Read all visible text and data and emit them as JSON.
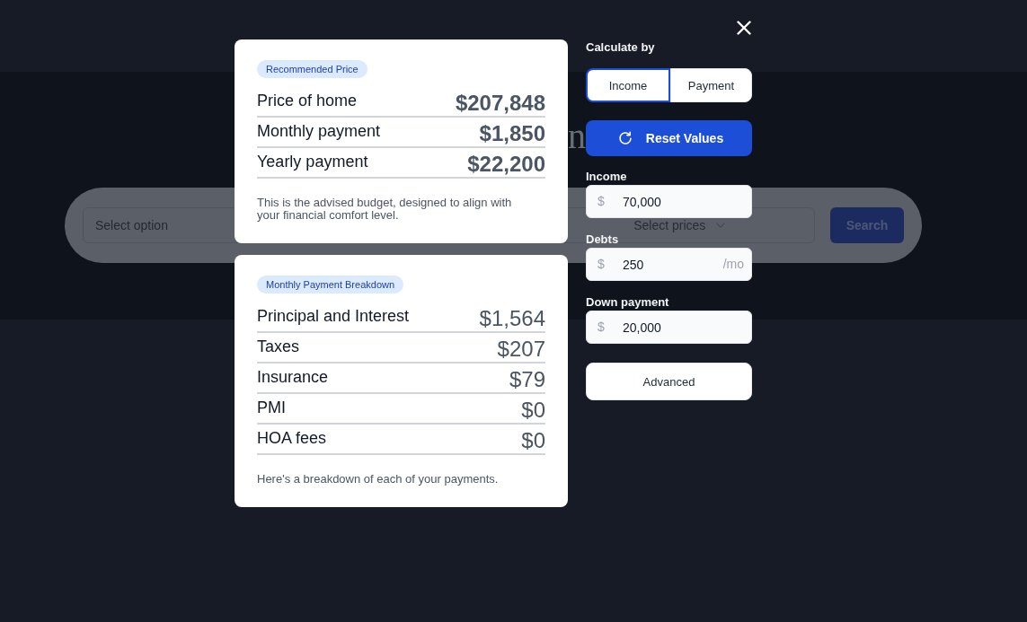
{
  "page": {
    "heading": "n",
    "search": {
      "option_select": {
        "placeholder": "Select option"
      },
      "price_select": {
        "label": "Select prices"
      },
      "search_button": "Search"
    }
  },
  "modal": {
    "cards": [
      {
        "kind": "summary",
        "badge": "Recommended Price",
        "rows": [
          {
            "label": "Price of home",
            "value": "$207,848"
          },
          {
            "label": "Monthly payment",
            "value": "$1,850"
          },
          {
            "label": "Yearly payment",
            "value": "$22,200"
          }
        ],
        "note": "This is the advised budget, designed to align with your financial comfort level."
      },
      {
        "kind": "breakdown",
        "badge": "Monthly Payment Breakdown",
        "rows": [
          {
            "label": "Principal and Interest",
            "value": "$1,564"
          },
          {
            "label": "Taxes",
            "value": "$207"
          },
          {
            "label": "Insurance",
            "value": "$79"
          },
          {
            "label": "PMI",
            "value": "$0"
          },
          {
            "label": "HOA fees",
            "value": "$0"
          }
        ],
        "note": "Here's a breakdown of each of your payments."
      }
    ],
    "calculate_by": {
      "label": "Calculate by",
      "options": [
        {
          "label": "Income",
          "selected": true
        },
        {
          "label": "Payment",
          "selected": false
        }
      ]
    },
    "reset_button": "Reset Values",
    "fields": [
      {
        "label": "Income",
        "prefix": "$",
        "value": "70,000"
      },
      {
        "label": "Debts",
        "prefix": "$",
        "value": "250",
        "suffix": "/mo"
      },
      {
        "label": "Down payment",
        "prefix": "$",
        "value": "20,000"
      }
    ],
    "advanced_button": "Advanced"
  }
}
